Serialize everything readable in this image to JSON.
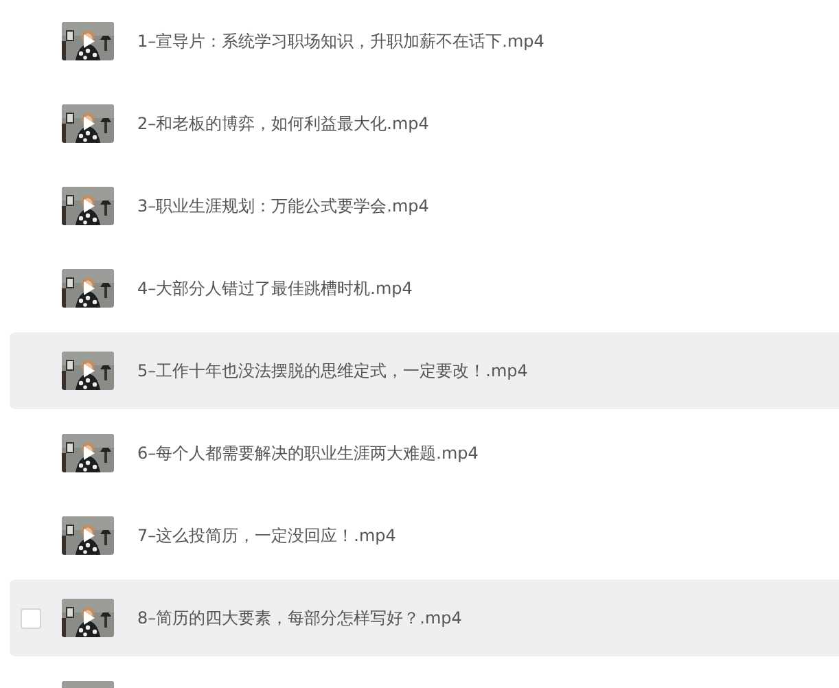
{
  "files": [
    {
      "kind": "video",
      "title": "1–宣导片：系统学习职场知识，升职加薪不在话下.mp4",
      "highlighted": false,
      "hovered": false
    },
    {
      "kind": "video",
      "title": "2–和老板的博弈，如何利益最大化.mp4",
      "highlighted": false,
      "hovered": false
    },
    {
      "kind": "video",
      "title": "3–职业生涯规划：万能公式要学会.mp4",
      "highlighted": false,
      "hovered": false
    },
    {
      "kind": "video",
      "title": "4–大部分人错过了最佳跳槽时机.mp4",
      "highlighted": false,
      "hovered": false
    },
    {
      "kind": "video",
      "title": "5–工作十年也没法摆脱的思维定式，一定要改！.mp4",
      "highlighted": true,
      "hovered": false
    },
    {
      "kind": "video",
      "title": "6–每个人都需要解决的职业生涯两大难题.mp4",
      "highlighted": false,
      "hovered": false
    },
    {
      "kind": "video",
      "title": "7–这么投简历，一定没回应！.mp4",
      "highlighted": false,
      "hovered": false
    },
    {
      "kind": "video",
      "title": "8–简历的四大要素，每部分怎样写好？.mp4",
      "highlighted": true,
      "hovered": true
    },
    {
      "kind": "partial"
    }
  ]
}
